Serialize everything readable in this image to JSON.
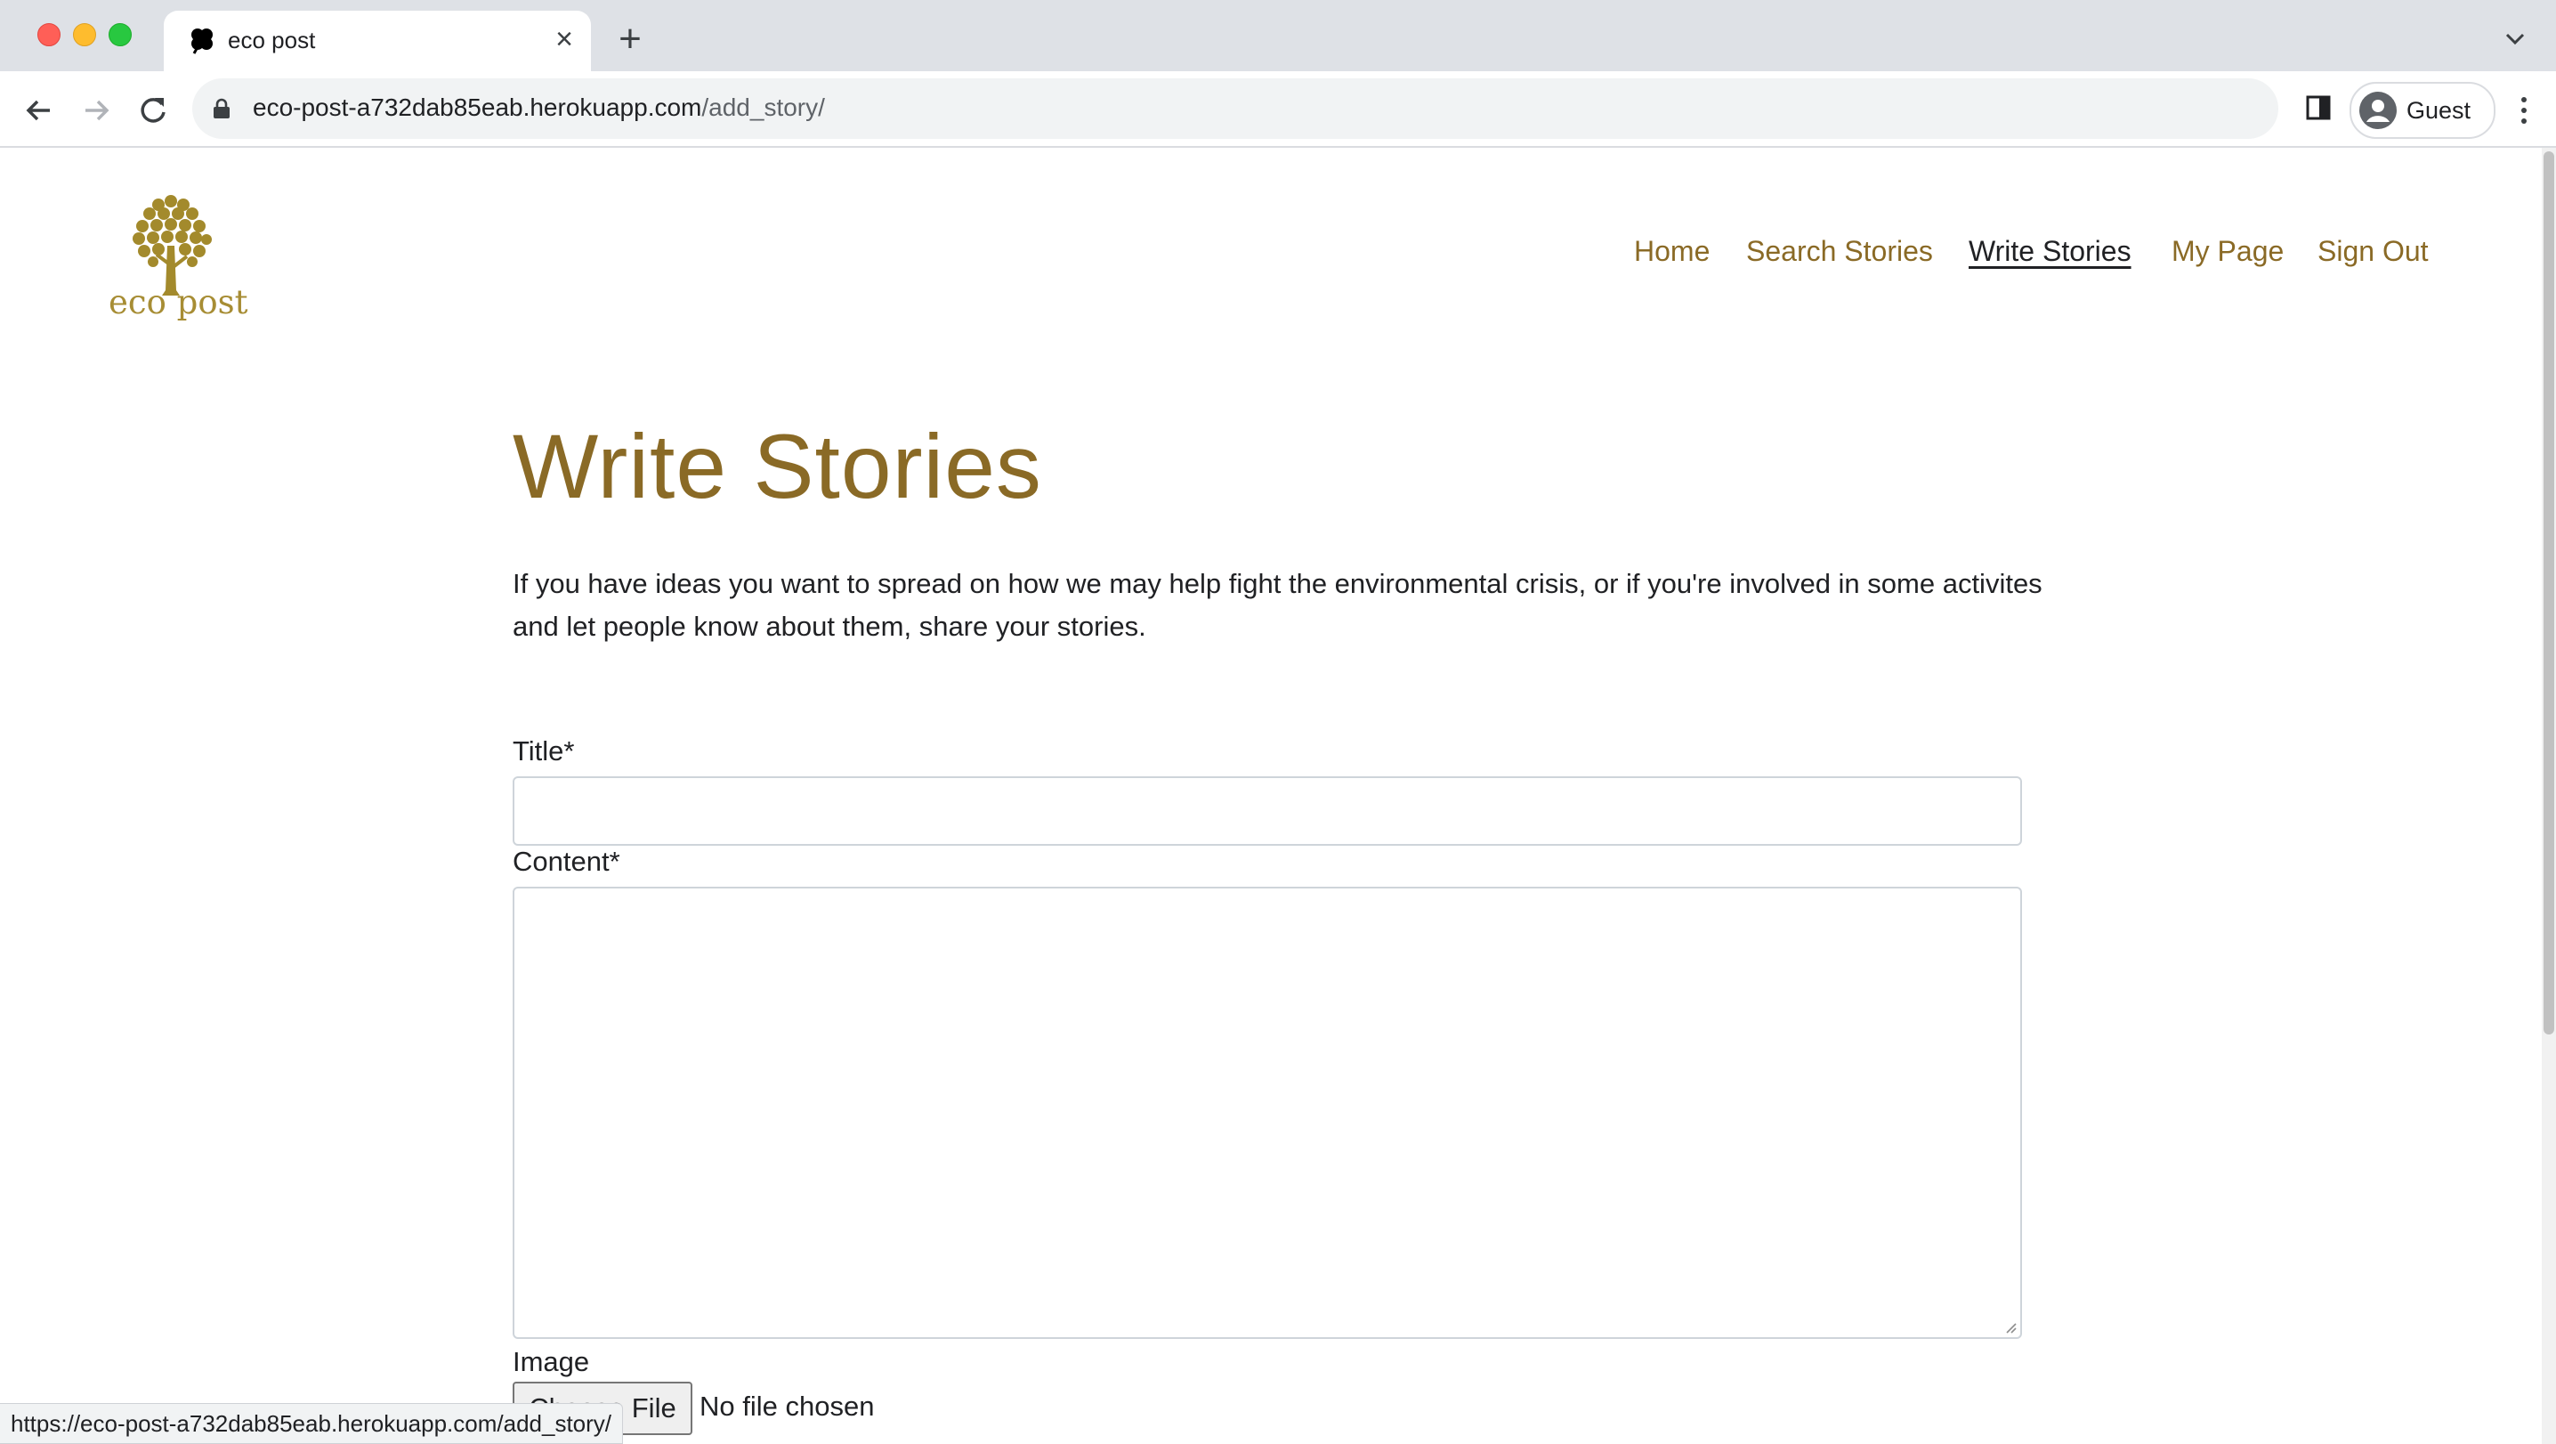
{
  "browser": {
    "tab": {
      "title": "eco post"
    },
    "address": {
      "host": "eco-post-a732dab85eab.herokuapp.com",
      "path": "/add_story/"
    },
    "profile_label": "Guest",
    "status_url": "https://eco-post-a732dab85eab.herokuapp.com/add_story/"
  },
  "site": {
    "logo_text": "eco post",
    "nav": [
      {
        "label": "Home"
      },
      {
        "label": "Search Stories"
      },
      {
        "label": "Write Stories",
        "active": true
      },
      {
        "label": "My Page"
      },
      {
        "label": "Sign Out"
      }
    ]
  },
  "main": {
    "heading": "Write Stories",
    "intro": "If you have ideas you want to spread on how we may help fight the environmental crisis, or if you're involved in some activites and let people know about them, share your stories."
  },
  "form": {
    "title_label": "Title*",
    "title_value": "",
    "content_label": "Content*",
    "content_value": "",
    "image_label": "Image",
    "choose_file_label": "Choose File",
    "no_file_text": "No file chosen"
  },
  "colors": {
    "brand": "#8a6a26",
    "logo": "#a78d34"
  }
}
